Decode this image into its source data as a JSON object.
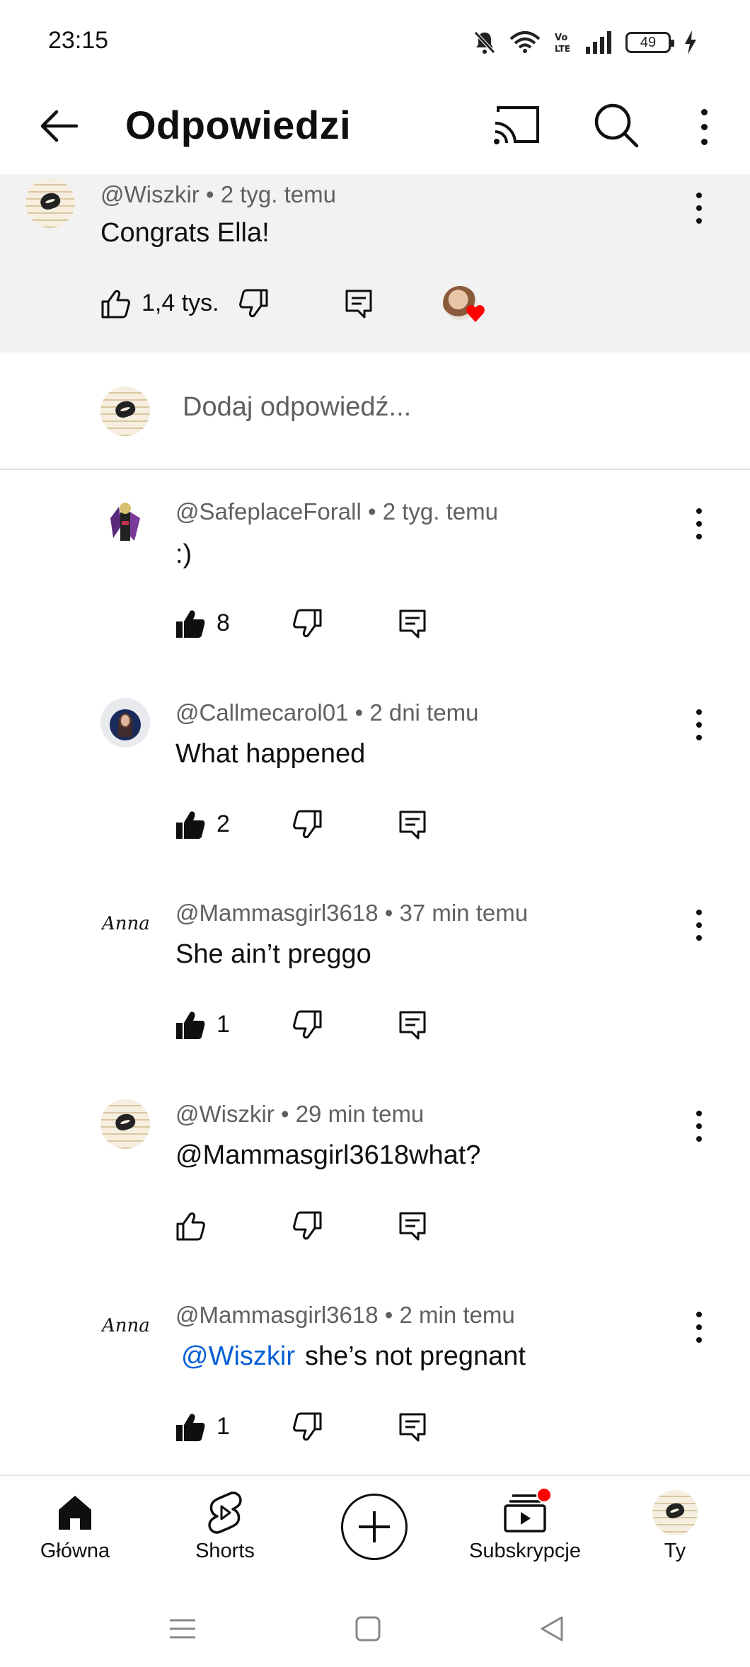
{
  "status_bar": {
    "time": "23:15",
    "battery": "49",
    "icons": [
      "mute-bell-icon",
      "wifi-icon",
      "volte-icon",
      "signal-icon",
      "battery-icon",
      "charging-icon"
    ]
  },
  "top_bar": {
    "title": "Odpowiedzi",
    "icons": [
      "back-arrow-icon",
      "cast-icon",
      "search-icon",
      "more-vert-icon"
    ]
  },
  "parent_comment": {
    "author": "@Wiszkir",
    "time": "2 tyg. temu",
    "text": "Congrats Ella!",
    "likes": "1,4 tys.",
    "creator_heart": true
  },
  "add_reply": {
    "placeholder": "Dodaj odpowiedź..."
  },
  "replies": [
    {
      "author": "@SafeplaceForall",
      "time": "2 tyg. temu",
      "text": ":)",
      "likes": "8",
      "liked": true,
      "avatar": "character-avatar"
    },
    {
      "author": "@Callmecarol01",
      "time": "2 dni temu",
      "text": "What happened",
      "likes": "2",
      "liked": true,
      "avatar": "portrait-avatar"
    },
    {
      "author": "@Mammasgirl3618",
      "time": "37 min temu",
      "text": "She ain’t preggo",
      "likes": "1",
      "liked": true,
      "avatar": "anna-avatar"
    },
    {
      "author": "@Wiszkir",
      "time": "29 min temu",
      "text": "@Mammasgirl3618what?",
      "likes": "",
      "liked": false,
      "avatar": "lips-avatar"
    },
    {
      "author": "@Mammasgirl3618",
      "time": "2 min temu",
      "mention": "@Wiszkir",
      "text": "she’s not pregnant",
      "likes": "1",
      "liked": true,
      "avatar": "anna-avatar"
    }
  ],
  "avatar_text": {
    "anna": "Anna"
  },
  "bottom_nav": {
    "items": [
      {
        "label": "Główna",
        "icon": "home-icon"
      },
      {
        "label": "Shorts",
        "icon": "shorts-icon"
      },
      {
        "label": "",
        "icon": "create-plus-icon"
      },
      {
        "label": "Subskrypcje",
        "icon": "subscriptions-icon"
      },
      {
        "label": "Ty",
        "icon": "profile-avatar"
      }
    ]
  },
  "colors": {
    "mention": "#065fd4",
    "highlight_bg": "#f2f2f2",
    "heart": "#ff0000",
    "notification": "#ff0000"
  }
}
